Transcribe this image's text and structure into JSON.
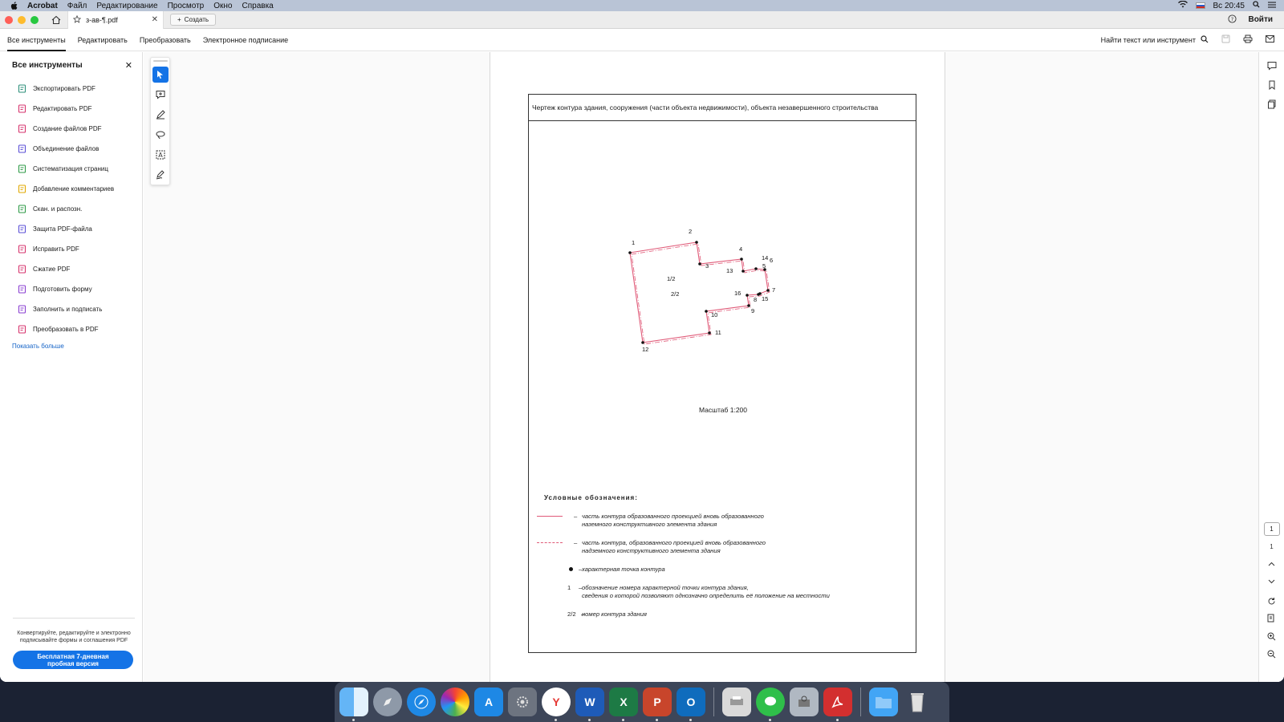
{
  "menubar": {
    "app": "Acrobat",
    "items": [
      "Файл",
      "Редактирование",
      "Просмотр",
      "Окно",
      "Справка"
    ],
    "clock": "Вс 20:45"
  },
  "tabbar": {
    "doc_title": "з-ав-¶.pdf",
    "create_label": "Создать",
    "login_label": "Войти"
  },
  "toolbar": {
    "tabs": [
      "Все инструменты",
      "Редактировать",
      "Преобразовать",
      "Электронное подписание"
    ],
    "search_label": "Найти текст или инструмент"
  },
  "leftpanel": {
    "title": "Все инструменты",
    "tools": [
      {
        "label": "Экспортировать PDF",
        "icon": "export-pdf-icon",
        "color": "#2d8f7a"
      },
      {
        "label": "Редактировать PDF",
        "icon": "edit-pdf-icon",
        "color": "#d6336c"
      },
      {
        "label": "Создание файлов PDF",
        "icon": "create-pdf-icon",
        "color": "#d6336c"
      },
      {
        "label": "Объединение файлов",
        "icon": "combine-files-icon",
        "color": "#5b4fd6"
      },
      {
        "label": "Систематизация страниц",
        "icon": "organize-pages-icon",
        "color": "#2e9a46"
      },
      {
        "label": "Добавление комментариев",
        "icon": "comment-icon",
        "color": "#e0a800"
      },
      {
        "label": "Скан. и распозн.",
        "icon": "scan-icon",
        "color": "#2e9a46"
      },
      {
        "label": "Защита PDF-файла",
        "icon": "protect-icon",
        "color": "#5b4fd6"
      },
      {
        "label": "Исправить PDF",
        "icon": "fix-pdf-icon",
        "color": "#d6336c"
      },
      {
        "label": "Сжатие PDF",
        "icon": "compress-icon",
        "color": "#d6336c"
      },
      {
        "label": "Подготовить форму",
        "icon": "prepare-form-icon",
        "color": "#8a3fd1"
      },
      {
        "label": "Заполнить и подписать",
        "icon": "fill-sign-icon",
        "color": "#8a3fd1"
      },
      {
        "label": "Преобразовать в PDF",
        "icon": "convert-pdf-icon",
        "color": "#d6336c"
      }
    ],
    "show_more": "Показать больше",
    "promo_text": "Конвертируйте, редактируйте и электронно подписывайте формы и соглашения PDF",
    "trial_label": "Бесплатная 7-дневная пробная версия"
  },
  "document": {
    "header": "Чертеж контура здания, сооружения (части объекта недвижимости), объекта незавершенного строительства",
    "scale": "Масштаб 1:200",
    "points": [
      "1",
      "2",
      "3",
      "4",
      "5",
      "6",
      "7",
      "8",
      "9",
      "10",
      "11",
      "12",
      "13",
      "14",
      "15",
      "16"
    ],
    "contour_labels": [
      "1/2",
      "2/2"
    ],
    "legend_title": "Условные обозначения:",
    "legend": [
      {
        "line1": "часть  контура образованного проекцией вновь образованного",
        "line2": "наземного конструктивного элемента здания"
      },
      {
        "line1": "часть контура, образованного проекцией вновь образованного",
        "line2": "надземного конструктивного элемента здания"
      },
      {
        "line1": "характерная точка контура",
        "line2": ""
      },
      {
        "line1": "обозначение номера характерной точки контура здания,",
        "line2": "сведения о которой позволяют однозначно определить её положение на местности",
        "symbol": "1"
      },
      {
        "line1": "номер контура здания",
        "line2": "",
        "symbol": "2/2"
      }
    ]
  },
  "rightrail": {
    "page_current": "1",
    "page_total": "1"
  },
  "colors": {
    "accent": "#1473e6",
    "contour": "#e05a78"
  }
}
